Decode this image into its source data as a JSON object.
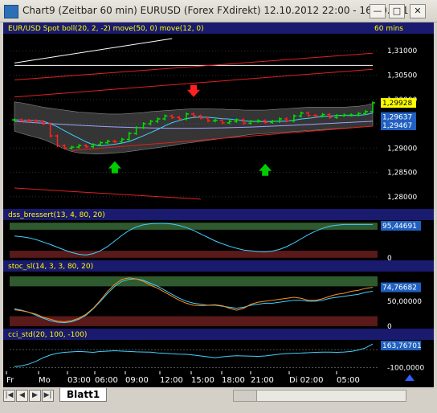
{
  "window": {
    "title": "Chart9 (Zeitbar 60 min)  EURUSD (Forex FXdirekt) 12.10.2012 22:00 - 16.10.201"
  },
  "chart_header": {
    "left": "EUR/USD Spot boll(20, 2, -2) move(50, 0) move(12, 0)",
    "right": "60 mins"
  },
  "time_axis": {
    "labels": [
      "Fr",
      "Mo",
      "03:00",
      "06:00",
      "09:00",
      "12:00",
      "15:00",
      "18:00",
      "21:00",
      "Di 02:00",
      "05:00"
    ]
  },
  "sheet_tab": "Blatt1",
  "colors": {
    "background": "#000000",
    "panel_header": "#1a1a6e",
    "up_candle": "#00e000",
    "down_candle": "#ff2020",
    "band_fill": "#606060",
    "arrow_up": "#00cc00",
    "arrow_down": "#ff2020",
    "overbought_zone": "#2f5a2f",
    "oversold_zone": "#5a1a1a",
    "line_cyan": "#40d0ff",
    "line_orange": "#ff9020",
    "label_yellow": "#ffff00"
  },
  "chart_data": [
    {
      "type": "candlestick",
      "title": "EUR/USD Spot boll(20, 2, -2) move(50, 0) move(12, 0)",
      "timeframe": "60 mins",
      "ylim": [
        1.2775,
        1.3135
      ],
      "yticks": [
        1.28,
        1.285,
        1.29,
        1.295,
        1.3,
        1.305,
        1.31
      ],
      "ytick_labels": [
        "1,28000",
        "1,28500",
        "1,29000",
        "",
        "1,30000",
        "1,30500",
        "1,31000"
      ],
      "last_labels": [
        {
          "text": "1,29928",
          "value": 1.29928,
          "style": "yellow"
        },
        {
          "text": "1,29637",
          "value": 1.29637,
          "style": "cyan"
        },
        {
          "text": "1,29467",
          "value": 1.29467,
          "style": "cyan"
        }
      ],
      "closes": [
        1.2958,
        1.2957,
        1.2956,
        1.2955,
        1.295,
        1.2925,
        1.2905,
        1.29,
        1.2902,
        1.2905,
        1.2903,
        1.2907,
        1.2911,
        1.2914,
        1.2913,
        1.2918,
        1.293,
        1.2942,
        1.295,
        1.2955,
        1.296,
        1.2966,
        1.2963,
        1.296,
        1.297,
        1.2966,
        1.2962,
        1.2956,
        1.2957,
        1.2952,
        1.2955,
        1.2958,
        1.2951,
        1.2955,
        1.2956,
        1.2953,
        1.2955,
        1.296,
        1.2956,
        1.2966,
        1.2972,
        1.2967,
        1.2966,
        1.2969,
        1.2963,
        1.2967,
        1.2968,
        1.2968,
        1.2971,
        1.2975,
        1.2993
      ],
      "bollinger": {
        "upper": [
          1.2995,
          1.2993,
          1.299,
          1.2987,
          1.2984,
          1.2982,
          1.298,
          1.2978,
          1.2976,
          1.2974,
          1.2973,
          1.2972,
          1.2971,
          1.297,
          1.297,
          1.297,
          1.2971,
          1.2972,
          1.2973,
          1.2975,
          1.2976,
          1.2977,
          1.2978,
          1.2979,
          1.298,
          1.2981,
          1.2981,
          1.2981,
          1.298,
          1.298,
          1.2979,
          1.2979,
          1.2978,
          1.2978,
          1.2978,
          1.2978,
          1.2979,
          1.298,
          1.2981,
          1.2982,
          1.2983,
          1.2984,
          1.2984,
          1.2984,
          1.2984,
          1.2984,
          1.2984,
          1.2985,
          1.2986,
          1.2988,
          1.2992
        ],
        "lower": [
          1.2935,
          1.293,
          1.2926,
          1.2922,
          1.2918,
          1.2912,
          1.2905,
          1.2898,
          1.2893,
          1.289,
          1.2889,
          1.2888,
          1.2888,
          1.2889,
          1.289,
          1.2891,
          1.2893,
          1.2895,
          1.2897,
          1.2899,
          1.2901,
          1.2903,
          1.2905,
          1.2908,
          1.291,
          1.2912,
          1.2914,
          1.2916,
          1.2918,
          1.292,
          1.2922,
          1.2924,
          1.2926,
          1.2928,
          1.2929,
          1.293,
          1.2931,
          1.2932,
          1.2933,
          1.2934,
          1.2935,
          1.2936,
          1.2937,
          1.2938,
          1.2939,
          1.294,
          1.2941,
          1.2942,
          1.2943,
          1.2944,
          1.2945
        ]
      },
      "moving_averages": [
        {
          "name": "move(50, 0)",
          "end_value": 1.29467
        },
        {
          "name": "move(12, 0)",
          "end_value": 1.29637
        }
      ],
      "trendlines": [
        {
          "color": "white",
          "from": [
            0,
            1.3075
          ],
          "to": [
            22,
            1.3125
          ]
        },
        {
          "color": "white",
          "from": [
            0,
            1.307
          ],
          "to": [
            50,
            1.307
          ]
        },
        {
          "color": "red",
          "from": [
            0,
            1.304
          ],
          "to": [
            50,
            1.3095
          ]
        },
        {
          "color": "red",
          "from": [
            0,
            1.3005
          ],
          "to": [
            50,
            1.3062
          ]
        },
        {
          "color": "red",
          "from": [
            8,
            1.2895
          ],
          "to": [
            50,
            1.2945
          ]
        },
        {
          "color": "red",
          "from": [
            0,
            1.2818
          ],
          "to": [
            26,
            1.2795
          ]
        }
      ],
      "annotations": [
        {
          "type": "arrow-down",
          "bar": 25,
          "value": 1.301
        },
        {
          "type": "arrow-up",
          "bar": 14,
          "value": 1.2868
        },
        {
          "type": "arrow-up",
          "bar": 35,
          "value": 1.2863
        }
      ]
    },
    {
      "type": "line",
      "title": "dss_bressert(13, 4, 80, 20)",
      "ylim": [
        -5,
        105
      ],
      "ytick_labels": [
        "0",
        "95,44691"
      ],
      "last_value_label": "95,44691",
      "series": [
        {
          "values": [
            62,
            60,
            57,
            52,
            45,
            38,
            30,
            22,
            15,
            10,
            8,
            12,
            20,
            32,
            48,
            64,
            78,
            88,
            94,
            97,
            98,
            98,
            96,
            92,
            86,
            78,
            68,
            58,
            48,
            40,
            33,
            27,
            22,
            20,
            18,
            17,
            19,
            24,
            32,
            42,
            54,
            66,
            76,
            84,
            90,
            93,
            95,
            95,
            95,
            95,
            95
          ]
        }
      ]
    },
    {
      "type": "line",
      "title": "stoc_sl(14, 3, 3, 80, 20)",
      "ylim": [
        -5,
        108
      ],
      "ytick_labels": [
        "50,00000",
        "0",
        "74,76682"
      ],
      "last_value_label": "74,76682",
      "series": [
        {
          "values": [
            35,
            32,
            28,
            22,
            16,
            11,
            8,
            7,
            9,
            14,
            22,
            35,
            50,
            66,
            80,
            90,
            94,
            95,
            92,
            86,
            80,
            72,
            64,
            56,
            50,
            46,
            44,
            42,
            42,
            40,
            38,
            36,
            38,
            42,
            44,
            46,
            46,
            48,
            50,
            52,
            52,
            50,
            50,
            52,
            56,
            58,
            60,
            62,
            64,
            68,
            70
          ]
        },
        {
          "values": [
            33,
            31,
            28,
            24,
            18,
            14,
            10,
            9,
            11,
            16,
            24,
            36,
            52,
            70,
            84,
            94,
            97,
            95,
            90,
            82,
            76,
            68,
            60,
            52,
            46,
            42,
            41,
            42,
            43,
            41,
            36,
            32,
            36,
            44,
            48,
            50,
            52,
            54,
            56,
            58,
            56,
            52,
            52,
            55,
            60,
            64,
            66,
            70,
            72,
            76,
            78
          ]
        }
      ]
    },
    {
      "type": "line",
      "title": "cci_std(20, 100, -100)",
      "ylim": [
        -140,
        200
      ],
      "ytick_labels": [
        "-100,0000",
        "163,76701"
      ],
      "last_value_label": "163,76701",
      "series": [
        {
          "values": [
            -90,
            -80,
            -60,
            -30,
            10,
            40,
            60,
            70,
            76,
            80,
            76,
            70,
            80,
            84,
            88,
            84,
            80,
            76,
            74,
            72,
            64,
            60,
            54,
            50,
            48,
            40,
            30,
            20,
            10,
            20,
            28,
            32,
            30,
            28,
            26,
            30,
            40,
            50,
            56,
            60,
            62,
            66,
            70,
            72,
            72,
            70,
            74,
            80,
            96,
            120,
            164
          ]
        }
      ]
    }
  ]
}
